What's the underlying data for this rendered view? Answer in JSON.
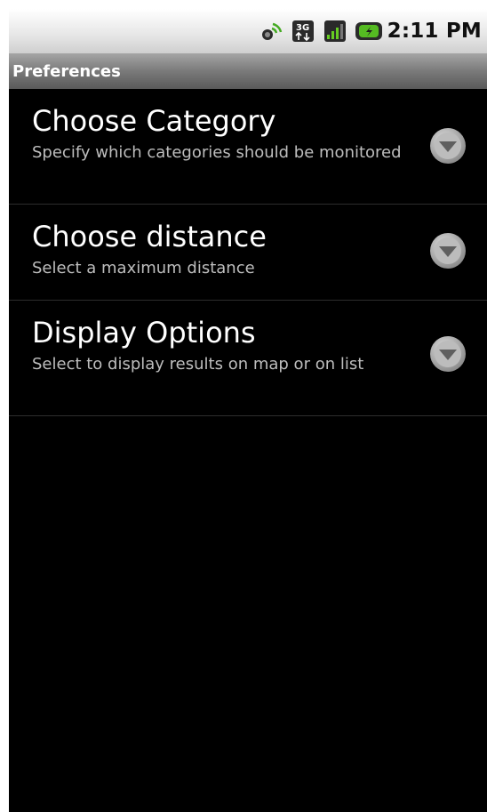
{
  "status_bar": {
    "time": "2:11 PM",
    "icons": [
      "gps-signal-icon",
      "3g-data-icon",
      "signal-strength-icon",
      "battery-icon"
    ]
  },
  "title_bar": {
    "title": "Preferences"
  },
  "preferences": [
    {
      "title": "Choose Category",
      "summary": "Specify which categories should be monitored"
    },
    {
      "title": "Choose distance",
      "summary": "Select a maximum distance"
    },
    {
      "title": "Display Options",
      "summary": "Select to display results on map or on list"
    }
  ],
  "colors": {
    "background": "#000000",
    "title_bar": "#7a7a7a",
    "summary_text": "#bdbdbd",
    "status_bar": "#e6e6e6"
  }
}
